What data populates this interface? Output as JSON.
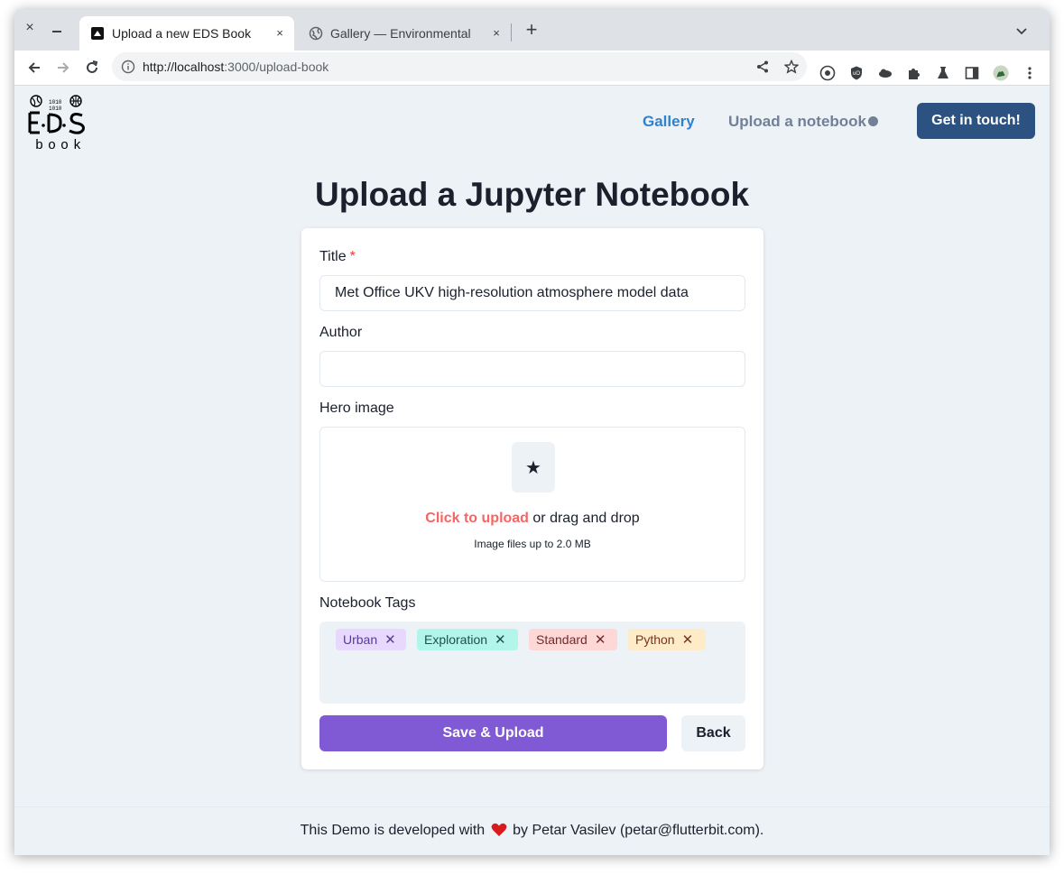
{
  "browser": {
    "tabs": [
      {
        "title": "Upload a new EDS Book",
        "active": true
      },
      {
        "title": "Gallery — Environmental",
        "active": false
      }
    ],
    "url_host": "http://localhost",
    "url_path": ":3000/upload-book",
    "close_glyph": "×",
    "new_tab_glyph": "+"
  },
  "header": {
    "nav": {
      "gallery": "Gallery",
      "upload": "Upload a notebook"
    },
    "cta": "Get in touch!"
  },
  "main": {
    "title": "Upload a Jupyter Notebook",
    "form": {
      "title_label": "Title",
      "required_mark": "*",
      "title_value": "Met Office UKV high-resolution atmosphere model data",
      "author_label": "Author",
      "author_value": "",
      "hero_label": "Hero image",
      "upload_icon_glyph": "★",
      "upload_link": "Click to upload",
      "upload_rest": " or drag and drop",
      "upload_hint": "Image files up to 2.0 MB",
      "tags_label": "Notebook Tags",
      "tags": [
        {
          "label": "Urban",
          "bg": "#e9d8fd",
          "fg": "#553c9a"
        },
        {
          "label": "Exploration",
          "bg": "#b2f5ea",
          "fg": "#234e52"
        },
        {
          "label": "Standard",
          "bg": "#fed7d7",
          "fg": "#742a2a"
        },
        {
          "label": "Python",
          "bg": "#feebc8",
          "fg": "#7b341e"
        }
      ],
      "remove_glyph": "✕",
      "save_button": "Save & Upload",
      "back_button": "Back"
    }
  },
  "footer": {
    "before": "This Demo is developed with",
    "after": "by Petar Vasilev (petar@flutterbit.com)."
  },
  "colors": {
    "accent_blue": "#3182ce",
    "cta_bg": "#2c5282",
    "save_bg": "#805ad5",
    "link_red": "#f56565"
  }
}
